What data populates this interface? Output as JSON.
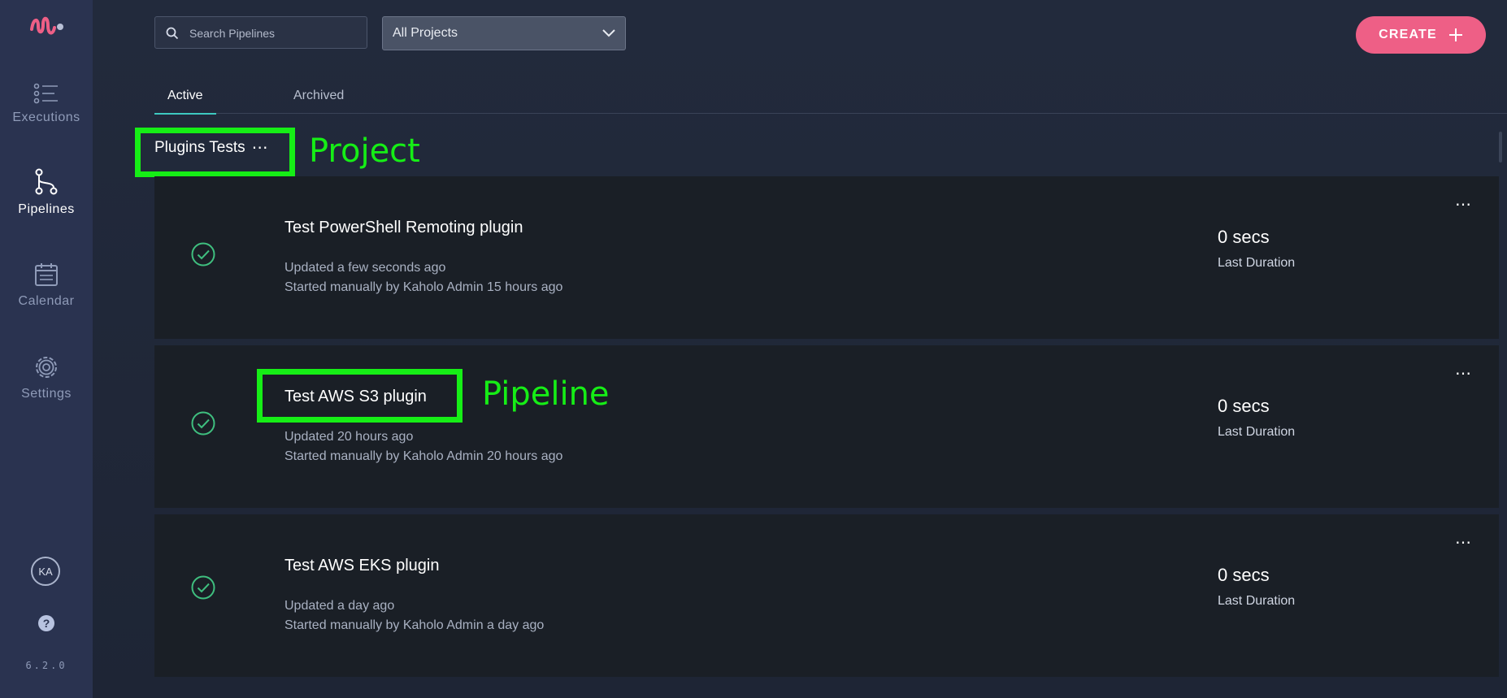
{
  "sidebar": {
    "logo": "kaholo-logo",
    "items": [
      {
        "label": "Executions",
        "icon": "executions-icon"
      },
      {
        "label": "Pipelines",
        "icon": "pipelines-icon",
        "active": true
      },
      {
        "label": "Calendar",
        "icon": "calendar-icon"
      },
      {
        "label": "Settings",
        "icon": "gear-icon"
      }
    ],
    "avatar": "KA",
    "help_icon": "help-icon",
    "version": "6.2.0"
  },
  "toolbar": {
    "search_placeholder": "Search Pipelines",
    "project_filter": "All Projects",
    "create_label": "CREATE"
  },
  "tabs": [
    {
      "label": "Active",
      "active": true
    },
    {
      "label": "Archived",
      "active": false
    }
  ],
  "project": {
    "name": "Plugins Tests",
    "menu": "⋯"
  },
  "annotations": {
    "project_label": "Project",
    "pipeline_label": "Pipeline",
    "color": "#16ee16"
  },
  "pipelines": [
    {
      "title": "Test PowerShell Remoting plugin",
      "updated": "Updated a few seconds ago",
      "started": "Started manually by Kaholo Admin 15 hours ago",
      "duration": "0 secs",
      "duration_label": "Last Duration",
      "status": "success"
    },
    {
      "title": "Test AWS S3 plugin",
      "updated": "Updated 20 hours ago",
      "started": "Started manually by Kaholo Admin 20 hours ago",
      "duration": "0 secs",
      "duration_label": "Last Duration",
      "status": "success"
    },
    {
      "title": "Test AWS EKS plugin",
      "updated": "Updated a day ago",
      "started": "Started manually by Kaholo Admin a day ago",
      "duration": "0 secs",
      "duration_label": "Last Duration",
      "status": "success"
    }
  ],
  "colors": {
    "accent": "#ee5f86",
    "tab_indicator": "#3ec9c0",
    "success": "#3fbf7f"
  }
}
